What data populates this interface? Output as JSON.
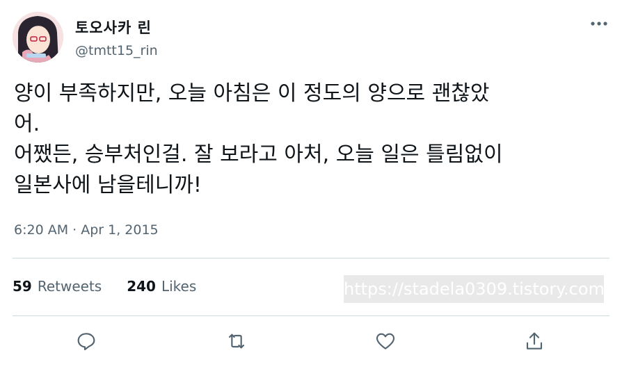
{
  "author": {
    "display_name": "토오사카 린",
    "handle": "@tmtt15_rin"
  },
  "tweet": {
    "lines": [
      "양이 부족하지만, 오늘 아침은 이 정도의 양으로 괜찮았",
      "어.",
      "어쨌든, 승부처인걸. 잘 보라고 아처, 오늘 일은 틀림없이",
      "일본사에 남을테니까!"
    ],
    "timestamp": "6:20 AM · Apr 1, 2015"
  },
  "stats": {
    "retweets_count": "59",
    "retweets_label": "Retweets",
    "likes_count": "240",
    "likes_label": "Likes"
  },
  "watermark": "https://stadela0309.tistory.com",
  "icons": {
    "more": "more-horizontal-icon",
    "reply": "reply-icon",
    "retweet": "retweet-icon",
    "like": "heart-icon",
    "share": "share-icon"
  },
  "colors": {
    "text_primary": "#0f1419",
    "text_secondary": "#536471",
    "divider": "#cfd9de"
  }
}
